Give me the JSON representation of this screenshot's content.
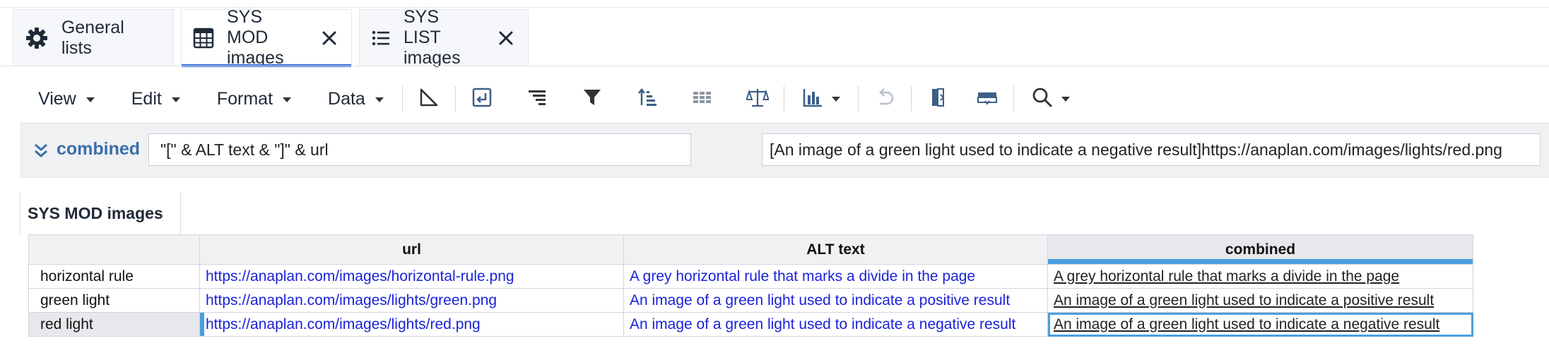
{
  "tabs": [
    {
      "label": "General lists",
      "icon": "gear-icon",
      "active": false,
      "closable": false
    },
    {
      "label": "SYS MOD images",
      "icon": "grid-module-icon",
      "active": true,
      "closable": true
    },
    {
      "label": "SYS LIST images",
      "icon": "list-icon",
      "active": false,
      "closable": true
    }
  ],
  "toolbar": {
    "menus": [
      "View",
      "Edit",
      "Format",
      "Data"
    ],
    "tools": [
      "pivot-icon",
      "insert-icon",
      "indent-icon",
      "filter-icon",
      "sort-icon",
      "show-hide-icon",
      "scale-icon",
      "chart-icon",
      "undo-icon",
      "freeze-column-icon",
      "freeze-row-icon",
      "search-icon"
    ]
  },
  "formula_bar": {
    "line_item": "combined",
    "formula": "\"[\" & ALT text & \"]\" & url",
    "result": "[An image of a green light used to indicate a negative result]https://anaplan.com/images/lights/red.png"
  },
  "module": {
    "title": "SYS MOD images"
  },
  "grid": {
    "columns": [
      "url",
      "ALT text",
      "combined"
    ],
    "rows": [
      {
        "label": "horizontal rule",
        "url": "https://anaplan.com/images/horizontal-rule.png",
        "alt": "A grey horizontal rule that marks a divide in the page",
        "combined": "A grey horizontal rule that marks a divide in the page"
      },
      {
        "label": "green light",
        "url": "https://anaplan.com/images/lights/green.png",
        "alt": "An image of a green light used to indicate a positive result",
        "combined": "An image of a green light used to indicate a positive result"
      },
      {
        "label": "red light",
        "url": "https://anaplan.com/images/lights/red.png",
        "alt": "An image of a green light used to indicate a negative result",
        "combined": "An image of a green light used to indicate a negative result"
      }
    ]
  },
  "colors": {
    "accent": "#3a6fd8",
    "selection": "#4a9fde",
    "link": "#1a23d8",
    "label": "#3b6ea8"
  }
}
